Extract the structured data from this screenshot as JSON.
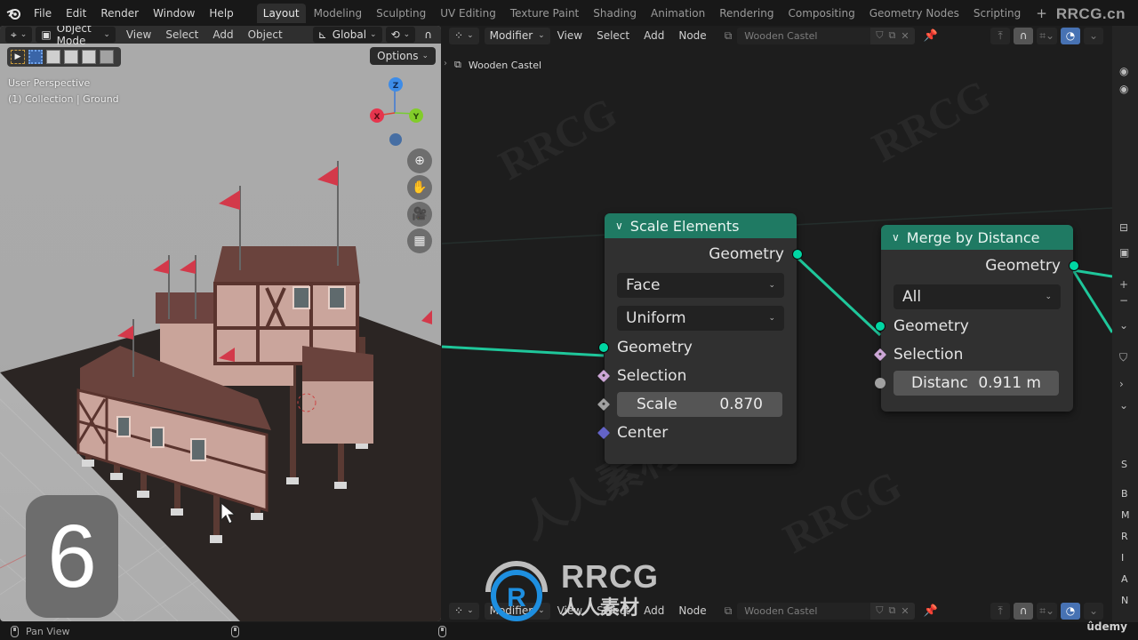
{
  "topbar": {
    "menus": [
      "File",
      "Edit",
      "Render",
      "Window",
      "Help"
    ],
    "workspaces": [
      {
        "label": "Layout",
        "active": true
      },
      {
        "label": "Modeling",
        "active": false
      },
      {
        "label": "Sculpting",
        "active": false
      },
      {
        "label": "UV Editing",
        "active": false
      },
      {
        "label": "Texture Paint",
        "active": false
      },
      {
        "label": "Shading",
        "active": false
      },
      {
        "label": "Animation",
        "active": false
      },
      {
        "label": "Rendering",
        "active": false
      },
      {
        "label": "Compositing",
        "active": false
      },
      {
        "label": "Geometry Nodes",
        "active": false
      },
      {
        "label": "Scripting",
        "active": false
      }
    ],
    "add_workspace": "+",
    "watermark": "RRCG.cn"
  },
  "viewport": {
    "mode": "Object Mode",
    "menus": [
      "View",
      "Select",
      "Add",
      "Object"
    ],
    "orientation": "Global",
    "options_label": "Options",
    "info_line1": "User Perspective",
    "info_line2": "(1) Collection | Ground",
    "gizmo": {
      "x": "X",
      "y": "Y",
      "z": "Z"
    },
    "step_number": "6"
  },
  "node_editor": {
    "editor_type": "Modifier",
    "menus": [
      "View",
      "Select",
      "Add",
      "Node"
    ],
    "node_group": "Wooden Castel",
    "breadcrumb": "Wooden Castel",
    "nodes": {
      "scale_elements": {
        "title": "Scale Elements",
        "output": "Geometry",
        "domain": "Face",
        "scale_mode": "Uniform",
        "inputs": {
          "geometry": "Geometry",
          "selection": "Selection",
          "scale_label": "Scale",
          "scale_value": "0.870",
          "center": "Center"
        }
      },
      "merge_by_distance": {
        "title": "Merge by Distance",
        "output": "Geometry",
        "mode": "All",
        "inputs": {
          "geometry": "Geometry",
          "selection": "Selection",
          "distance_label": "Distanc",
          "distance_value": "0.911 m"
        }
      }
    },
    "colors": {
      "node_header": "#1f7a63",
      "geometry_socket": "#00d6a3",
      "wire": "#1fc79b"
    }
  },
  "sidebar_letters": [
    "S",
    "B",
    "M",
    "R",
    "I",
    "A",
    "N"
  ],
  "statusbar": {
    "action": "Pan View"
  },
  "branding": {
    "logo_text": "RRCG",
    "logo_cn": "人人素材",
    "udemy": "ûdemy"
  }
}
